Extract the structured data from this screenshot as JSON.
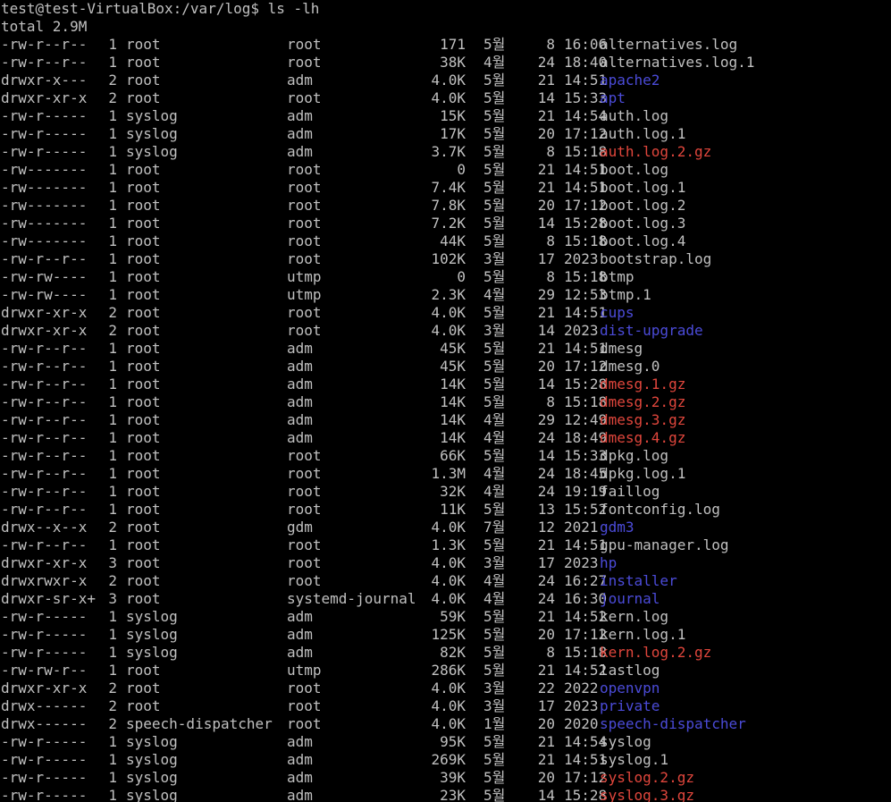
{
  "terminal": {
    "prompt": "test@test-VirtualBox:/var/log$ ls -lh",
    "total": "total 2.9M",
    "colors": {
      "file": "#c0c0c0",
      "dir": "#4b4bd8",
      "archive": "#e0463c",
      "background": "#000000"
    },
    "entries": [
      {
        "perms": "-rw-r--r--",
        "links": "1",
        "owner": "root",
        "group": "root",
        "size": "171",
        "month": "5월",
        "day": "8",
        "time": "16:06",
        "name": "alternatives.log",
        "kind": "file"
      },
      {
        "perms": "-rw-r--r--",
        "links": "1",
        "owner": "root",
        "group": "root",
        "size": "38K",
        "month": "4월",
        "day": "24",
        "time": "18:40",
        "name": "alternatives.log.1",
        "kind": "file"
      },
      {
        "perms": "drwxr-x---",
        "links": "2",
        "owner": "root",
        "group": "adm",
        "size": "4.0K",
        "month": "5월",
        "day": "21",
        "time": "14:51",
        "name": "apache2",
        "kind": "dir"
      },
      {
        "perms": "drwxr-xr-x",
        "links": "2",
        "owner": "root",
        "group": "root",
        "size": "4.0K",
        "month": "5월",
        "day": "14",
        "time": "15:33",
        "name": "apt",
        "kind": "dir"
      },
      {
        "perms": "-rw-r-----",
        "links": "1",
        "owner": "syslog",
        "group": "adm",
        "size": "15K",
        "month": "5월",
        "day": "21",
        "time": "14:54",
        "name": "auth.log",
        "kind": "file"
      },
      {
        "perms": "-rw-r-----",
        "links": "1",
        "owner": "syslog",
        "group": "adm",
        "size": "17K",
        "month": "5월",
        "day": "20",
        "time": "17:12",
        "name": "auth.log.1",
        "kind": "file"
      },
      {
        "perms": "-rw-r-----",
        "links": "1",
        "owner": "syslog",
        "group": "adm",
        "size": "3.7K",
        "month": "5월",
        "day": "8",
        "time": "15:18",
        "name": "auth.log.2.gz",
        "kind": "archive"
      },
      {
        "perms": "-rw-------",
        "links": "1",
        "owner": "root",
        "group": "root",
        "size": "0",
        "month": "5월",
        "day": "21",
        "time": "14:51",
        "name": "boot.log",
        "kind": "file"
      },
      {
        "perms": "-rw-------",
        "links": "1",
        "owner": "root",
        "group": "root",
        "size": "7.4K",
        "month": "5월",
        "day": "21",
        "time": "14:51",
        "name": "boot.log.1",
        "kind": "file"
      },
      {
        "perms": "-rw-------",
        "links": "1",
        "owner": "root",
        "group": "root",
        "size": "7.8K",
        "month": "5월",
        "day": "20",
        "time": "17:12",
        "name": "boot.log.2",
        "kind": "file"
      },
      {
        "perms": "-rw-------",
        "links": "1",
        "owner": "root",
        "group": "root",
        "size": "7.2K",
        "month": "5월",
        "day": "14",
        "time": "15:28",
        "name": "boot.log.3",
        "kind": "file"
      },
      {
        "perms": "-rw-------",
        "links": "1",
        "owner": "root",
        "group": "root",
        "size": "44K",
        "month": "5월",
        "day": "8",
        "time": "15:18",
        "name": "boot.log.4",
        "kind": "file"
      },
      {
        "perms": "-rw-r--r--",
        "links": "1",
        "owner": "root",
        "group": "root",
        "size": "102K",
        "month": "3월",
        "day": "17",
        "time": "2023",
        "name": "bootstrap.log",
        "kind": "file"
      },
      {
        "perms": "-rw-rw----",
        "links": "1",
        "owner": "root",
        "group": "utmp",
        "size": "0",
        "month": "5월",
        "day": "8",
        "time": "15:18",
        "name": "btmp",
        "kind": "file"
      },
      {
        "perms": "-rw-rw----",
        "links": "1",
        "owner": "root",
        "group": "utmp",
        "size": "2.3K",
        "month": "4월",
        "day": "29",
        "time": "12:53",
        "name": "btmp.1",
        "kind": "file"
      },
      {
        "perms": "drwxr-xr-x",
        "links": "2",
        "owner": "root",
        "group": "root",
        "size": "4.0K",
        "month": "5월",
        "day": "21",
        "time": "14:51",
        "name": "cups",
        "kind": "dir"
      },
      {
        "perms": "drwxr-xr-x",
        "links": "2",
        "owner": "root",
        "group": "root",
        "size": "4.0K",
        "month": "3월",
        "day": "14",
        "time": "2023",
        "name": "dist-upgrade",
        "kind": "dir"
      },
      {
        "perms": "-rw-r--r--",
        "links": "1",
        "owner": "root",
        "group": "adm",
        "size": "45K",
        "month": "5월",
        "day": "21",
        "time": "14:51",
        "name": "dmesg",
        "kind": "file"
      },
      {
        "perms": "-rw-r--r--",
        "links": "1",
        "owner": "root",
        "group": "adm",
        "size": "45K",
        "month": "5월",
        "day": "20",
        "time": "17:12",
        "name": "dmesg.0",
        "kind": "file"
      },
      {
        "perms": "-rw-r--r--",
        "links": "1",
        "owner": "root",
        "group": "adm",
        "size": "14K",
        "month": "5월",
        "day": "14",
        "time": "15:28",
        "name": "dmesg.1.gz",
        "kind": "archive"
      },
      {
        "perms": "-rw-r--r--",
        "links": "1",
        "owner": "root",
        "group": "adm",
        "size": "14K",
        "month": "5월",
        "day": "8",
        "time": "15:18",
        "name": "dmesg.2.gz",
        "kind": "archive"
      },
      {
        "perms": "-rw-r--r--",
        "links": "1",
        "owner": "root",
        "group": "adm",
        "size": "14K",
        "month": "4월",
        "day": "29",
        "time": "12:49",
        "name": "dmesg.3.gz",
        "kind": "archive"
      },
      {
        "perms": "-rw-r--r--",
        "links": "1",
        "owner": "root",
        "group": "adm",
        "size": "14K",
        "month": "4월",
        "day": "24",
        "time": "18:49",
        "name": "dmesg.4.gz",
        "kind": "archive"
      },
      {
        "perms": "-rw-r--r--",
        "links": "1",
        "owner": "root",
        "group": "root",
        "size": "66K",
        "month": "5월",
        "day": "14",
        "time": "15:33",
        "name": "dpkg.log",
        "kind": "file"
      },
      {
        "perms": "-rw-r--r--",
        "links": "1",
        "owner": "root",
        "group": "root",
        "size": "1.3M",
        "month": "4월",
        "day": "24",
        "time": "18:45",
        "name": "dpkg.log.1",
        "kind": "file"
      },
      {
        "perms": "-rw-r--r--",
        "links": "1",
        "owner": "root",
        "group": "root",
        "size": "32K",
        "month": "4월",
        "day": "24",
        "time": "19:19",
        "name": "faillog",
        "kind": "file"
      },
      {
        "perms": "-rw-r--r--",
        "links": "1",
        "owner": "root",
        "group": "root",
        "size": "11K",
        "month": "5월",
        "day": "13",
        "time": "15:52",
        "name": "fontconfig.log",
        "kind": "file"
      },
      {
        "perms": "drwx--x--x",
        "links": "2",
        "owner": "root",
        "group": "gdm",
        "size": "4.0K",
        "month": "7월",
        "day": "12",
        "time": "2021",
        "name": "gdm3",
        "kind": "dir"
      },
      {
        "perms": "-rw-r--r--",
        "links": "1",
        "owner": "root",
        "group": "root",
        "size": "1.3K",
        "month": "5월",
        "day": "21",
        "time": "14:51",
        "name": "gpu-manager.log",
        "kind": "file"
      },
      {
        "perms": "drwxr-xr-x",
        "links": "3",
        "owner": "root",
        "group": "root",
        "size": "4.0K",
        "month": "3월",
        "day": "17",
        "time": "2023",
        "name": "hp",
        "kind": "dir"
      },
      {
        "perms": "drwxrwxr-x",
        "links": "2",
        "owner": "root",
        "group": "root",
        "size": "4.0K",
        "month": "4월",
        "day": "24",
        "time": "16:27",
        "name": "installer",
        "kind": "dir"
      },
      {
        "perms": "drwxr-sr-x+",
        "links": "3",
        "owner": "root",
        "group": "systemd-journal",
        "size": "4.0K",
        "month": "4월",
        "day": "24",
        "time": "16:30",
        "name": "journal",
        "kind": "dir"
      },
      {
        "perms": "-rw-r-----",
        "links": "1",
        "owner": "syslog",
        "group": "adm",
        "size": "59K",
        "month": "5월",
        "day": "21",
        "time": "14:52",
        "name": "kern.log",
        "kind": "file"
      },
      {
        "perms": "-rw-r-----",
        "links": "1",
        "owner": "syslog",
        "group": "adm",
        "size": "125K",
        "month": "5월",
        "day": "20",
        "time": "17:12",
        "name": "kern.log.1",
        "kind": "file"
      },
      {
        "perms": "-rw-r-----",
        "links": "1",
        "owner": "syslog",
        "group": "adm",
        "size": "82K",
        "month": "5월",
        "day": "8",
        "time": "15:18",
        "name": "kern.log.2.gz",
        "kind": "archive"
      },
      {
        "perms": "-rw-rw-r--",
        "links": "1",
        "owner": "root",
        "group": "utmp",
        "size": "286K",
        "month": "5월",
        "day": "21",
        "time": "14:52",
        "name": "lastlog",
        "kind": "file"
      },
      {
        "perms": "drwxr-xr-x",
        "links": "2",
        "owner": "root",
        "group": "root",
        "size": "4.0K",
        "month": "3월",
        "day": "22",
        "time": "2022",
        "name": "openvpn",
        "kind": "dir"
      },
      {
        "perms": "drwx------",
        "links": "2",
        "owner": "root",
        "group": "root",
        "size": "4.0K",
        "month": "3월",
        "day": "17",
        "time": "2023",
        "name": "private",
        "kind": "dir"
      },
      {
        "perms": "drwx------",
        "links": "2",
        "owner": "speech-dispatcher",
        "group": "root",
        "size": "4.0K",
        "month": "1월",
        "day": "20",
        "time": "2020",
        "name": "speech-dispatcher",
        "kind": "dir"
      },
      {
        "perms": "-rw-r-----",
        "links": "1",
        "owner": "syslog",
        "group": "adm",
        "size": "95K",
        "month": "5월",
        "day": "21",
        "time": "14:54",
        "name": "syslog",
        "kind": "file"
      },
      {
        "perms": "-rw-r-----",
        "links": "1",
        "owner": "syslog",
        "group": "adm",
        "size": "269K",
        "month": "5월",
        "day": "21",
        "time": "14:51",
        "name": "syslog.1",
        "kind": "file"
      },
      {
        "perms": "-rw-r-----",
        "links": "1",
        "owner": "syslog",
        "group": "adm",
        "size": "39K",
        "month": "5월",
        "day": "20",
        "time": "17:12",
        "name": "syslog.2.gz",
        "kind": "archive"
      },
      {
        "perms": "-rw-r-----",
        "links": "1",
        "owner": "syslog",
        "group": "adm",
        "size": "23K",
        "month": "5월",
        "day": "14",
        "time": "15:28",
        "name": "syslog.3.gz",
        "kind": "archive"
      }
    ]
  }
}
